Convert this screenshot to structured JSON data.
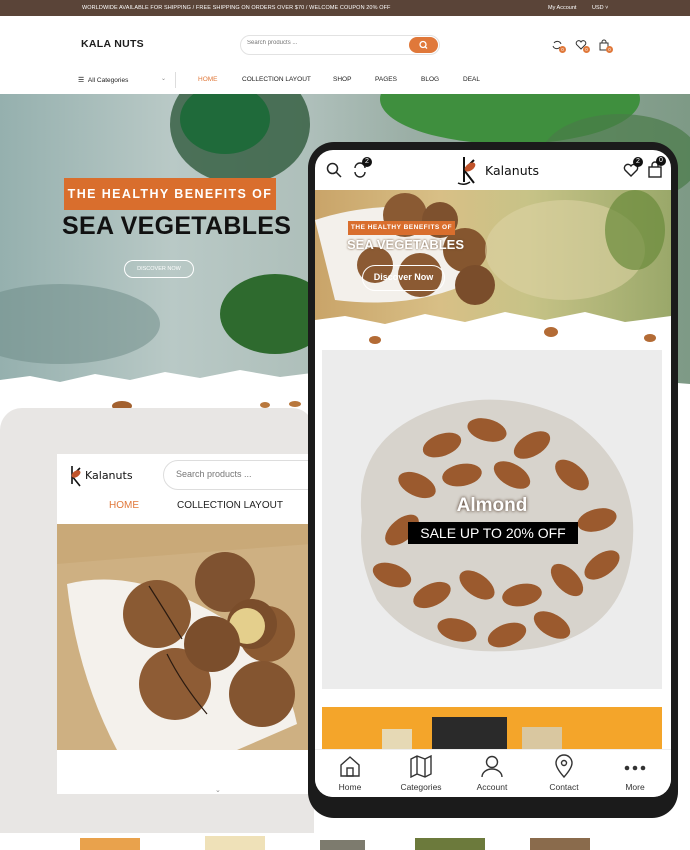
{
  "topbar": {
    "promo": "WORLDWIDE AVAILABLE FOR SHIPPING  / FREE SHIPPING ON ORDERS OVER $70  / WELCOME COUPON 20% OFF",
    "account": "My Account",
    "currency": "USD ˅"
  },
  "header": {
    "logo": "KALA NUTS",
    "search_placeholder": "Search products ...",
    "icons": [
      "compare-icon",
      "heart-icon",
      "bag-icon"
    ],
    "badges": [
      "0",
      "0",
      "0"
    ]
  },
  "nav": {
    "categories": "All Categories",
    "links": [
      "HOME",
      "COLLECTION LAYOUT",
      "SHOP",
      "PAGES",
      "BLOG",
      "DEAL"
    ]
  },
  "hero": {
    "tag": "THE HEALTHY BENEFITS OF",
    "title": "SEA VEGETABLES",
    "button": "DISCOVER NOW"
  },
  "tablet": {
    "logo": "Kalanuts",
    "search_placeholder": "Search products ...",
    "nav": [
      "HOME",
      "COLLECTION LAYOUT"
    ]
  },
  "phone": {
    "logo": "Kalanuts",
    "compare_badge": "2",
    "wishlist_badge": "2",
    "cart_badge": "0",
    "banner": {
      "tag": "THE HEALTHY BENEFITS OF",
      "title": "SEA VEGETABLES",
      "button": "Discover Now"
    },
    "promo": {
      "title": "Almond",
      "subtitle": "SALE UP TO 20% OFF"
    },
    "bottom_nav": [
      "Home",
      "Categories",
      "Account",
      "Contact",
      "More"
    ]
  },
  "colors": {
    "accent": "#e0783a",
    "topbar": "#5a4438",
    "phone_frame": "#1b1b1b"
  }
}
